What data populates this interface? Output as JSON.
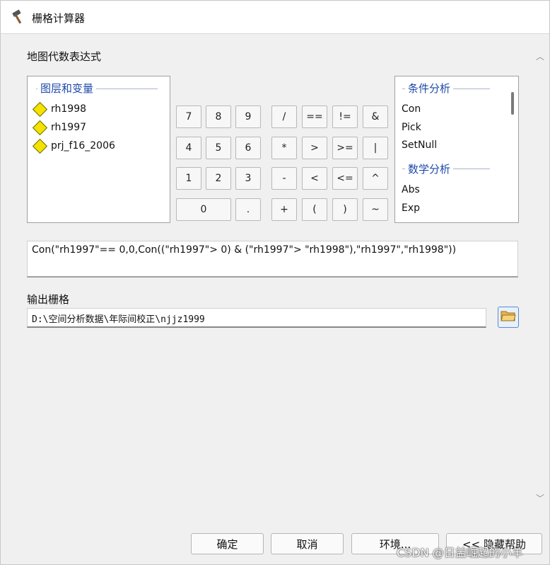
{
  "window": {
    "title": "栅格计算器",
    "icon": "hammer-icon"
  },
  "expression_label": "地图代数表达式",
  "layers": {
    "group_title": "图层和变量",
    "items": [
      "rh1998",
      "rh1997",
      "prj_f16_2006"
    ]
  },
  "keypad": {
    "row1": [
      "7",
      "8",
      "9",
      "/",
      "==",
      "!=",
      "&"
    ],
    "row2": [
      "4",
      "5",
      "6",
      "*",
      ">",
      ">=",
      "|"
    ],
    "row3": [
      "1",
      "2",
      "3",
      "-",
      "<",
      "<=",
      "^"
    ],
    "row4": [
      "0",
      ".",
      "+",
      "(",
      ")",
      "~"
    ]
  },
  "functions": {
    "group1": {
      "title": "条件分析",
      "items": [
        "Con",
        "Pick",
        "SetNull"
      ]
    },
    "group2": {
      "title": "数学分析",
      "items": [
        "Abs",
        "Exp"
      ]
    }
  },
  "expression": "Con(\"rh1997\"== 0,0,Con((\"rh1997\"> 0) & (\"rh1997\"> \"rh1998\"),\"rh1997\",\"rh1998\"))",
  "output": {
    "label": "输出栅格",
    "path": "D:\\空间分析数据\\年际间校正\\njjz1999",
    "browse_icon": "folder-open-icon"
  },
  "buttons": {
    "ok": "确定",
    "cancel": "取消",
    "environments": "环境...",
    "hide_help": "<< 隐藏帮助"
  },
  "watermark": "CSDN @日益崛起的小羊"
}
